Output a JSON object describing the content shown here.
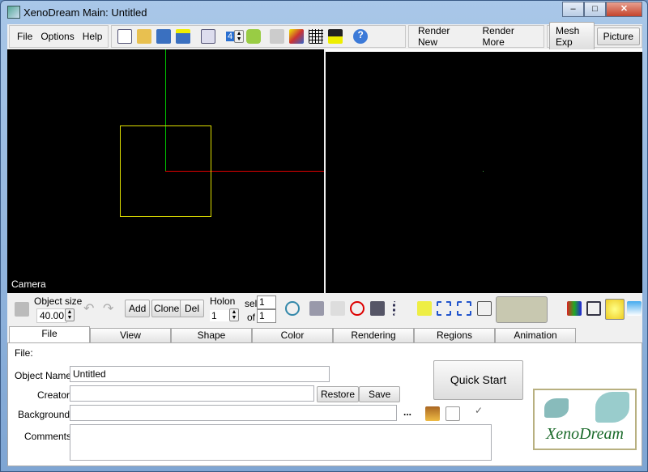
{
  "window": {
    "title": "XenoDream Main: Untitled",
    "minimize": "‒",
    "maximize": "□",
    "close": "✕"
  },
  "menu": [
    "File",
    "Options",
    "Help"
  ],
  "toolbar": {
    "spin_value": "4",
    "render_new": "Render New",
    "render_more": "Render More",
    "mesh_exp": "Mesh Exp",
    "picture": "Picture"
  },
  "viewports": {
    "left_label": "Camera"
  },
  "objbar": {
    "object_size_label": "Object size",
    "object_size_value": "40.00",
    "add": "Add",
    "clone": "Clone",
    "del": "Del",
    "holon_label": "Holon",
    "holon_value": "1",
    "sel_label": "sel",
    "sel_value": "1",
    "of_label": "of",
    "of_value": "1"
  },
  "tabs": [
    "File",
    "View",
    "Shape",
    "Color",
    "Rendering",
    "Regions",
    "Animation"
  ],
  "file_panel": {
    "heading": "File:",
    "object_name_label": "Object Name",
    "object_name_value": "Untitled",
    "creator_label": "Creator",
    "creator_value": "",
    "restore": "Restore",
    "save": "Save",
    "background_label": "Background",
    "background_value": "",
    "ellipsis": "...",
    "comments_label": "Comments",
    "comments_value": "",
    "quick_start": "Quick Start",
    "logo_text": "XenoDream"
  },
  "colors": {
    "axis_x": "#e00000",
    "axis_y": "#00c000",
    "object_box": "#e0e000"
  }
}
